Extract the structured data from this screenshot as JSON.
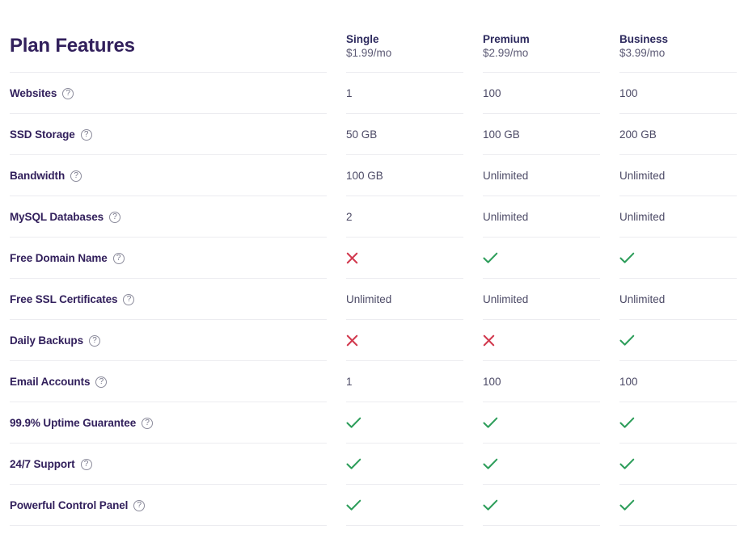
{
  "header": {
    "title": "Plan Features",
    "plans": [
      {
        "name": "Single",
        "price": "$1.99/mo"
      },
      {
        "name": "Premium",
        "price": "$2.99/mo"
      },
      {
        "name": "Business",
        "price": "$3.99/mo"
      }
    ]
  },
  "icons": {
    "help": "help-circle-icon",
    "check": "check-icon",
    "cross": "cross-icon"
  },
  "colors": {
    "title": "#32205c",
    "feature_label": "#32205c",
    "plan_name": "#2d2a5e",
    "plan_price": "#5c5a75",
    "value_text": "#4c4a66",
    "divider": "#ececf0",
    "check": "#2e9e5b",
    "cross": "#d23b50",
    "help_icon": "#8c8c9c",
    "background": "#ffffff"
  },
  "rows": [
    {
      "feature": "Websites",
      "values": [
        "1",
        "100",
        "100"
      ]
    },
    {
      "feature": "SSD Storage",
      "values": [
        "50 GB",
        "100 GB",
        "200 GB"
      ]
    },
    {
      "feature": "Bandwidth",
      "values": [
        "100 GB",
        "Unlimited",
        "Unlimited"
      ]
    },
    {
      "feature": "MySQL Databases",
      "values": [
        "2",
        "Unlimited",
        "Unlimited"
      ]
    },
    {
      "feature": "Free Domain Name",
      "values": [
        "cross",
        "check",
        "check"
      ]
    },
    {
      "feature": "Free SSL Certificates",
      "values": [
        "Unlimited",
        "Unlimited",
        "Unlimited"
      ]
    },
    {
      "feature": "Daily Backups",
      "values": [
        "cross",
        "cross",
        "check"
      ]
    },
    {
      "feature": "Email Accounts",
      "values": [
        "1",
        "100",
        "100"
      ]
    },
    {
      "feature": "99.9% Uptime Guarantee",
      "values": [
        "check",
        "check",
        "check"
      ]
    },
    {
      "feature": "24/7 Support",
      "values": [
        "check",
        "check",
        "check"
      ]
    },
    {
      "feature": "Powerful Control Panel",
      "values": [
        "check",
        "check",
        "check"
      ]
    }
  ]
}
